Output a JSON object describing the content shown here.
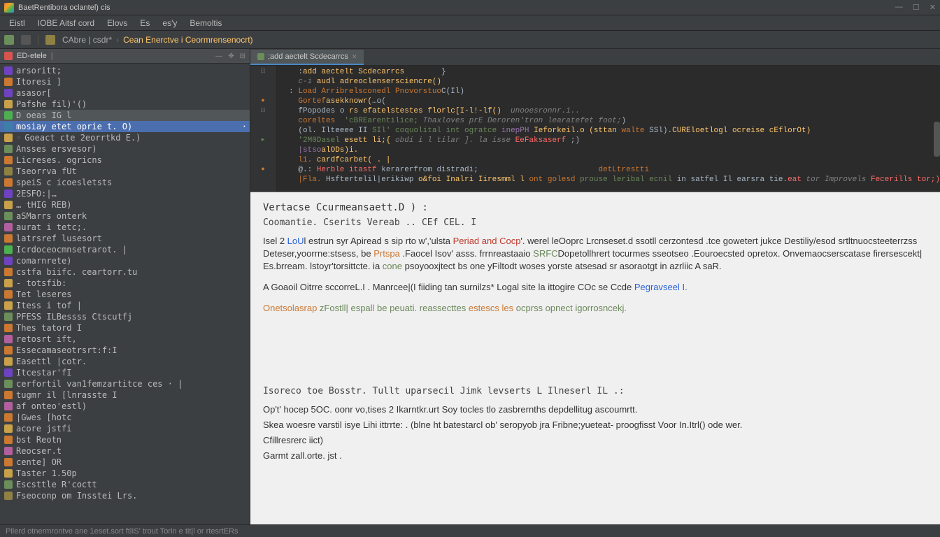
{
  "titlebar": {
    "title": "BaetRentibora  oclantel)  cis"
  },
  "menubar": {
    "items": [
      "Eistl",
      "IOBE Aitsf cord",
      "Elovs",
      "Es",
      "es'y",
      "Bemoltis"
    ]
  },
  "toolbar": {
    "breadcrumb": {
      "folder": "CAbre | csdr*",
      "func": "Cean Enerctve i Ceormrensenocrt)"
    }
  },
  "sidebar": {
    "title": "ED-etele",
    "items": [
      {
        "icon": "ic-var",
        "label": "arsoritt;"
      },
      {
        "icon": "ic-field",
        "label": "Itoresi ]"
      },
      {
        "icon": "ic-var",
        "label": "asasor["
      },
      {
        "icon": "ic-func",
        "label": "Pafshe fil)'()"
      },
      {
        "icon": "ic-class",
        "label": "D oeas IG l",
        "cls": "hl"
      },
      {
        "icon": "ic-meth",
        "label": "mosiay etet oprie t. O)",
        "cls": "sel pop"
      },
      {
        "icon": "ic-func",
        "label": "Goeact cte 2eorrtkd E.)",
        "arrow": true
      },
      {
        "icon": "ic-mod",
        "label": "Ansses ersvesor)"
      },
      {
        "icon": "ic-field",
        "label": "Licreses. ogricns"
      },
      {
        "icon": "ic-folder",
        "label": "Tseorrva fUt"
      },
      {
        "icon": "ic-field",
        "label": "speiS c  icoesletsts"
      },
      {
        "icon": "ic-var",
        "label": "2ESFO:|…"
      },
      {
        "icon": "ic-func",
        "label": "… tHIG REB)"
      },
      {
        "icon": "ic-mod",
        "label": "aSMarrs onterk"
      },
      {
        "icon": "ic-prop",
        "label": "aurat i tetc;."
      },
      {
        "icon": "ic-field",
        "label": "latrsref lusesort"
      },
      {
        "icon": "ic-class",
        "label": "Icrdoceocmnsetrarot. |"
      },
      {
        "icon": "ic-var",
        "label": "comarnrete)"
      },
      {
        "icon": "ic-field",
        "label": "cstfa biifc. ceartorr.tu"
      },
      {
        "icon": "ic-func",
        "label": "- totsfib:"
      },
      {
        "icon": "ic-field",
        "label": "Tet leseres"
      },
      {
        "icon": "ic-func",
        "label": "Itess i tof  |"
      },
      {
        "icon": "ic-mod",
        "label": "PFESS ILBessss Ctscutfj"
      },
      {
        "icon": "ic-field",
        "label": "Thes tatord I"
      },
      {
        "icon": "ic-prop",
        "label": "retosrt ift,"
      },
      {
        "icon": "ic-field",
        "label": "Essecamaseotrsrt:f:I"
      },
      {
        "icon": "ic-func",
        "label": "Easettl |cotr."
      },
      {
        "icon": "ic-var",
        "label": "Itcestar'fI"
      },
      {
        "icon": "ic-mod",
        "label": "cerfortil van1femzartitce ces · |"
      },
      {
        "icon": "ic-field",
        "label": "tugmr il [lnrasste I"
      },
      {
        "icon": "ic-prop",
        "label": "af onteo'estl)"
      },
      {
        "icon": "ic-field",
        "label": "|Gwes [hotc"
      },
      {
        "icon": "ic-func",
        "label": "acore jstfi"
      },
      {
        "icon": "ic-field",
        "label": "bst Reotn"
      },
      {
        "icon": "ic-prop",
        "label": "Reocser.t"
      },
      {
        "icon": "ic-field",
        "label": "cente] OR"
      },
      {
        "icon": "ic-func",
        "label": "Taster 1.50p"
      },
      {
        "icon": "ic-mod",
        "label": "Escsttle R'coctt"
      },
      {
        "icon": "ic-folder",
        "label": "Fseoconp om Insstei Lrs."
      }
    ]
  },
  "editor": {
    "tab": ";add aectelt Scdecarrcs",
    "lines": [
      {
        "pre": "    ",
        "tokens": [
          {
            "t": ":",
            "c": "op"
          },
          {
            "t": "add aectelt Scdecarrcs",
            "c": "func"
          },
          {
            "t": "        }",
            "c": "op"
          }
        ]
      },
      {
        "pre": "    ",
        "tokens": [
          {
            "t": "c-i ",
            "c": "com"
          },
          {
            "t": "audl adreoclensersciencre()",
            "c": "func"
          }
        ]
      },
      {
        "pre": "  : ",
        "tokens": [
          {
            "t": "Load Arribrelsconedl Pnovorstuo",
            "c": "orange"
          },
          {
            "t": "C(Il)",
            "c": "type"
          }
        ]
      },
      {
        "pre": "    ",
        "tokens": [
          {
            "t": "Gortef",
            "c": "kw"
          },
          {
            "t": "asekknowr(",
            "c": "func"
          },
          {
            "t": "…o(",
            "c": "op"
          }
        ]
      },
      {
        "pre": "    ",
        "tokens": [
          {
            "t": "fPopodes ",
            "c": "type"
          },
          {
            "t": "o ",
            "c": "op"
          },
          {
            "t": "rs efatelstestes florlc[I-l!-lf()",
            "c": "func"
          },
          {
            "t": "  unooesronnr.i..",
            "c": "com"
          }
        ]
      },
      {
        "pre": "    ",
        "tokens": [
          {
            "t": "coreltes ",
            "c": "orange"
          },
          {
            "t": " 'cBREarentilice; ",
            "c": "str"
          },
          {
            "t": "Thaxloves prE Deroren'tron learatefet foot;",
            "c": "com"
          },
          {
            "t": ")",
            "c": "op"
          }
        ]
      },
      {
        "pre": "    ",
        "tokens": [
          {
            "t": "(ol. ",
            "c": "op"
          },
          {
            "t": "Ilteeee II ",
            "c": "type"
          },
          {
            "t": "SIl' coquolital int ogratce ",
            "c": "str"
          },
          {
            "t": "inepPH ",
            "c": "hl-word"
          },
          {
            "t": "Ieforkeil.o (sttan ",
            "c": "func"
          },
          {
            "t": "walte ",
            "c": "kw"
          },
          {
            "t": "SSl).",
            "c": "type"
          },
          {
            "t": "CUREloetlogl ocreise cEflorOt)",
            "c": "func"
          }
        ]
      },
      {
        "pre": "    ",
        "tokens": [
          {
            "t": "'2M0Dasel ",
            "c": "str"
          },
          {
            "t": "esett li;{",
            "c": "func"
          },
          {
            "t": " obdi i l tilar ]. la isse ",
            "c": "com"
          },
          {
            "t": "EeFaksaserf",
            "c": "err"
          },
          {
            "t": " ;)",
            "c": "op"
          }
        ]
      },
      {
        "pre": "    ",
        "tokens": [
          {
            "t": "|stso",
            "c": "hl-word"
          },
          {
            "t": "alODs)i.",
            "c": "func"
          }
        ]
      },
      {
        "pre": "    ",
        "tokens": [
          {
            "t": "li. ",
            "c": "kw"
          },
          {
            "t": "cardfcarbet( . |",
            "c": "func"
          }
        ]
      },
      {
        "pre": "    ",
        "tokens": [
          {
            "t": "@.: ",
            "c": "op"
          },
          {
            "t": "Herble itastf",
            "c": "err"
          },
          {
            "t": " kerarerfrom distradi;",
            "c": "type"
          },
          {
            "t": "                          ",
            "c": "op"
          },
          {
            "t": "detLtrestti",
            "c": "orange"
          }
        ]
      },
      {
        "pre": "    ",
        "tokens": [
          {
            "t": "|Fla. ",
            "c": "kw"
          },
          {
            "t": "Hsftertelil|erikiwp",
            "c": "type"
          },
          {
            "t": " o&foi Inalri Iiresmml l",
            "c": "func"
          },
          {
            "t": " ont golesd",
            "c": "orange"
          },
          {
            "t": " prouse leribal ecnil",
            "c": "str"
          },
          {
            "t": " in satfel Il earsra tie.",
            "c": "type"
          },
          {
            "t": "eat",
            "c": "err"
          },
          {
            "t": " tor Improvels",
            "c": "com"
          },
          {
            "t": " Fecerills tor;)",
            "c": "err"
          }
        ]
      }
    ]
  },
  "doc": {
    "heading1": "Vertacse Ccurmeansaett.D  ) :",
    "heading2": "Coomantie.  Cserits Vereab .. CEf CEL. I",
    "para1_parts": [
      {
        "t": "Isel 2 ",
        "c": ""
      },
      {
        "t": "LoU",
        "c": "bl"
      },
      {
        "t": "l estrun syr Apiread s sip rto  w','ulsta ",
        "c": ""
      },
      {
        "t": "Periad and Cocp",
        "c": "rd"
      },
      {
        "t": "'.  werel leOoprc Lrcnseset.d  ssotll cerzontesd .tce  gowetert jukce Destiliy/esod  srtltnuocsteeterrzss Deteser,yoorrne:stsess, be ",
        "c": ""
      },
      {
        "t": "Prtspa",
        "c": "or"
      },
      {
        "t": " .Faocel Isov' asss. frrnreastaaio ",
        "c": ""
      },
      {
        "t": "SRFC",
        "c": "gr"
      },
      {
        "t": "Dopetollhrert  tocurmes  sseotseo .Eouroecsted opretox.   Onvemaocserscatase firersescekt| Es.brream. lstoyr'torsittcte. ia ",
        "c": ""
      },
      {
        "t": "cone",
        "c": "gr"
      },
      {
        "t": " psoyooxjtect bs one yFiltodt woses yorste  atsesad sr asoraotgt in azrliic  A saR.",
        "c": ""
      }
    ],
    "para2_parts": [
      {
        "t": "A Goaoil Oitrre sccorreL.I . Manrcee|(I fiiding tan surnilzs* Logal site la ittogire  COc  se Ccde ",
        "c": ""
      },
      {
        "t": "Pegravseel I.",
        "c": "bl"
      }
    ],
    "para3_parts": [
      {
        "t": "Onetsolasrap ",
        "c": "or"
      },
      {
        "t": "zFostll| espall  be peuati. reassecttes  ",
        "c": "gr"
      },
      {
        "t": "estescs les ",
        "c": "or"
      },
      {
        "t": "ocprss opnect igorrosncekj.",
        "c": "gr"
      }
    ],
    "heading3": "Isoreco toe Bosstr. Tullt uparsecil Jimk levserts L Ilneserl IL .:",
    "line1_parts": [
      {
        "t": "Op't'",
        "c": "gr"
      },
      {
        "t": " hocep 5OC.  oonr vo,tises 2 Ikarntkr.urt Soy  tocles tlo zasbrernths    ",
        "c": ""
      },
      {
        "t": "depdellitug ascoumrtt.",
        "c": "lnk"
      }
    ],
    "line2_parts": [
      {
        "t": "Skea",
        "c": "or"
      },
      {
        "t": " woesre varstil isye Lihi ittrrte: .  (blne  ht batestarcl ob' seropyob jra  ",
        "c": ""
      },
      {
        "t": "Fribne;yueteat-",
        "c": "db"
      },
      {
        "t": "  proogfisst ",
        "c": ""
      },
      {
        "t": "Voor",
        "c": "db"
      },
      {
        "t": " In.Itrl()  ode  wer.",
        "c": ""
      }
    ],
    "line3": "Cfillresrerc  iict)",
    "line4_parts": [
      {
        "t": "Garmt zall.orte. jst",
        "c": "gr"
      },
      {
        "t": " .",
        "c": ""
      }
    ]
  },
  "statusbar": {
    "text": "Pilerd otnermrontve ane 1eset.sort ftlIS'  trout Torin e tit|l or rtesrtERs"
  }
}
